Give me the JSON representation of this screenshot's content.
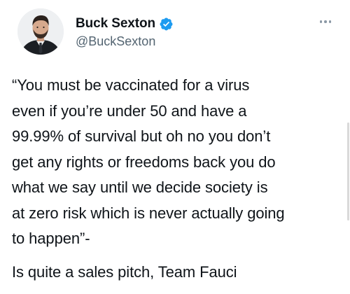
{
  "author": {
    "display_name": "Buck Sexton",
    "handle": "@BuckSexton",
    "verified_icon": "verified-badge-icon",
    "verified_color": "#1d9bf0"
  },
  "tweet": {
    "quote_text": "“You must be vaccinated for a virus\neven if you’re under 50 and have a\n99.99% of survival but oh no you don’t\nget any rights or freedoms back you do\nwhat we say until we decide society is\nat zero risk which is never actually going\nto happen”-",
    "comment_text": "Is quite a sales pitch, Team Fauci"
  },
  "menu": {
    "icon": "more-options-icon"
  },
  "colors": {
    "text": "#0f1419",
    "secondary": "#536471",
    "background": "#ffffff"
  }
}
